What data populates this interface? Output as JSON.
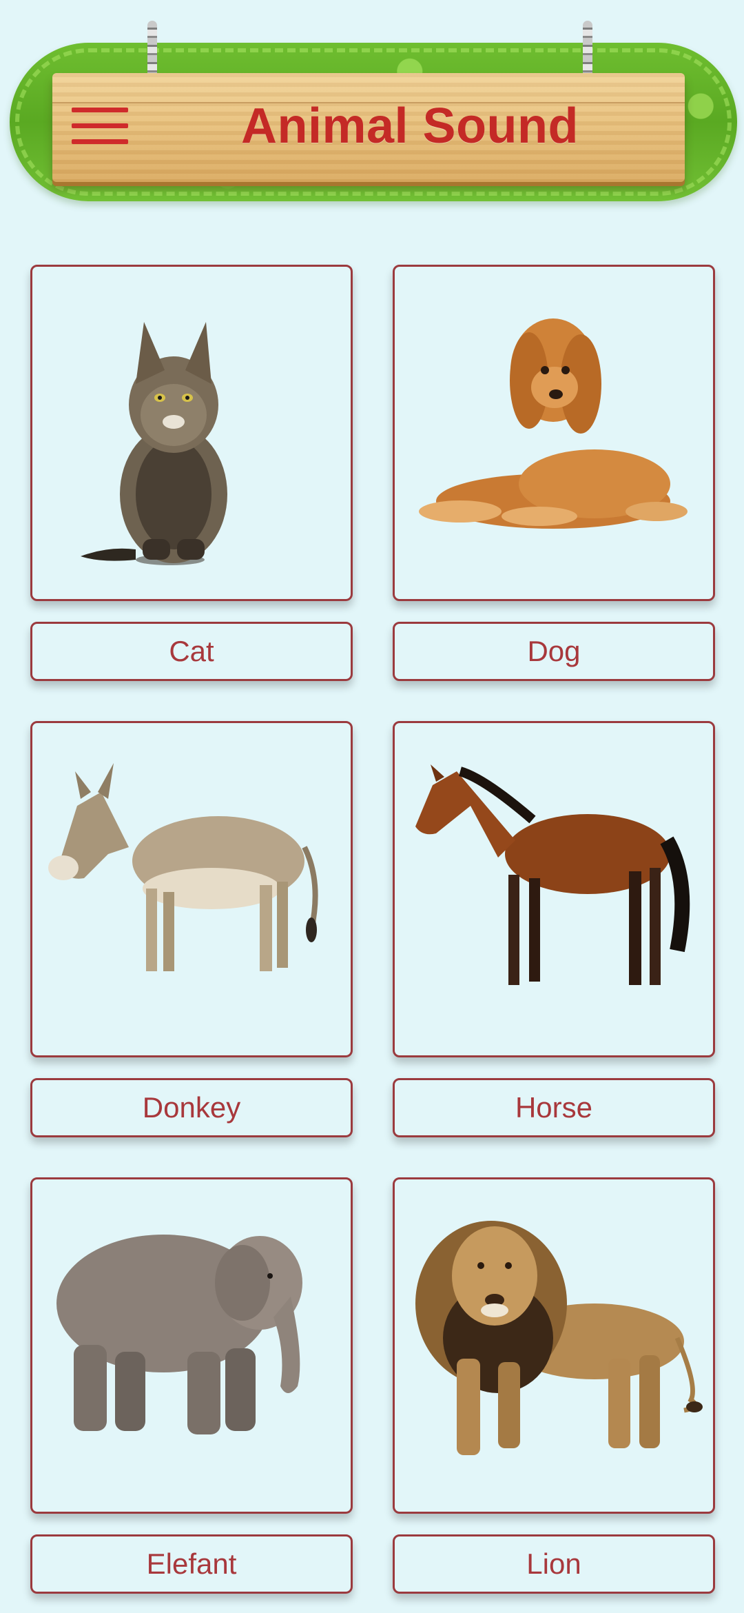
{
  "header": {
    "title": "Animal Sound",
    "menu_icon": "hamburger-menu-icon",
    "title_color": "#c42a26"
  },
  "colors": {
    "background": "#e2f6f9",
    "card_border": "#9b3a3e",
    "label_text": "#a8383c"
  },
  "animals": [
    {
      "name": "Cat",
      "image_icon": "cat-photo"
    },
    {
      "name": "Dog",
      "image_icon": "dog-photo"
    },
    {
      "name": "Donkey",
      "image_icon": "donkey-photo"
    },
    {
      "name": "Horse",
      "image_icon": "horse-photo"
    },
    {
      "name": "Elefant",
      "image_icon": "elephant-photo"
    },
    {
      "name": "Lion",
      "image_icon": "lion-photo"
    }
  ]
}
